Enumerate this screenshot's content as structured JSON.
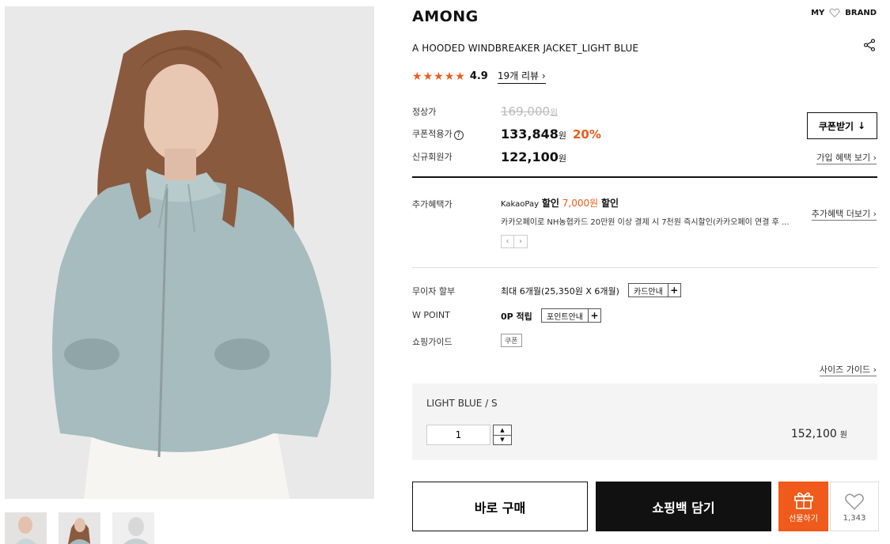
{
  "product": {
    "brand": "AMONG",
    "name": "A HOODED WINDBREAKER JACKET_LIGHT BLUE",
    "rating": "4.9",
    "rating_value": 4.9,
    "review_link": "19개 리뷰  ›"
  },
  "top_links": {
    "my": "MY",
    "brand": "BRAND"
  },
  "prices": {
    "regular_label": "정상가",
    "regular_value": "169,000",
    "regular_unit": "원",
    "coupon_label": "쿠폰적용가",
    "coupon_help": "?",
    "coupon_value": "133,848",
    "coupon_unit": "원",
    "discount": "20%",
    "member_label": "신규회원가",
    "member_value": "122,100",
    "member_unit": "원",
    "coupon_button": "쿠폰받기",
    "coupon_button_icon": "↓",
    "join_benefit_link": "가입 혜택 보기"
  },
  "benefits": {
    "label": "추가혜택가",
    "kakao": "KakaoPay",
    "discount_prefix": "할인",
    "discount_amount": "7,000원",
    "discount_suffix": "할인",
    "description": "카카오페이로 NH농협카드 20만원 이상 결제 시 7천원 즉시할인(카카오페이 연결 후 ...",
    "more_link": "추가혜택 더보기",
    "prev": "‹",
    "next": "›"
  },
  "info": {
    "installment_label": "무이자 할부",
    "installment_value": "최대 6개월(25,350원 X 6개월)",
    "card_guide": "카드안내",
    "point_label": "W POINT",
    "point_value": "0P 적립",
    "point_guide": "포인트안내",
    "plus": "+",
    "shopping_guide_label": "쇼핑가이드",
    "coupon_tag": "쿠폰",
    "size_guide_link": "사이즈 가이드"
  },
  "option": {
    "name": "LIGHT BLUE / S",
    "quantity": "1",
    "up": "▲",
    "down": "▼",
    "price": "152,100",
    "price_unit": "원"
  },
  "actions": {
    "buy_now": "바로 구매",
    "add_to_cart": "쇼핑백 담기",
    "gift": "선물하기",
    "like_count": "1,343"
  },
  "colors": {
    "accent": "#f05a1a",
    "dark": "#111111"
  },
  "icons": [
    "heart-icon",
    "share-icon",
    "star-icon",
    "question-icon",
    "download-icon",
    "gift-icon",
    "heart-outline-icon"
  ]
}
